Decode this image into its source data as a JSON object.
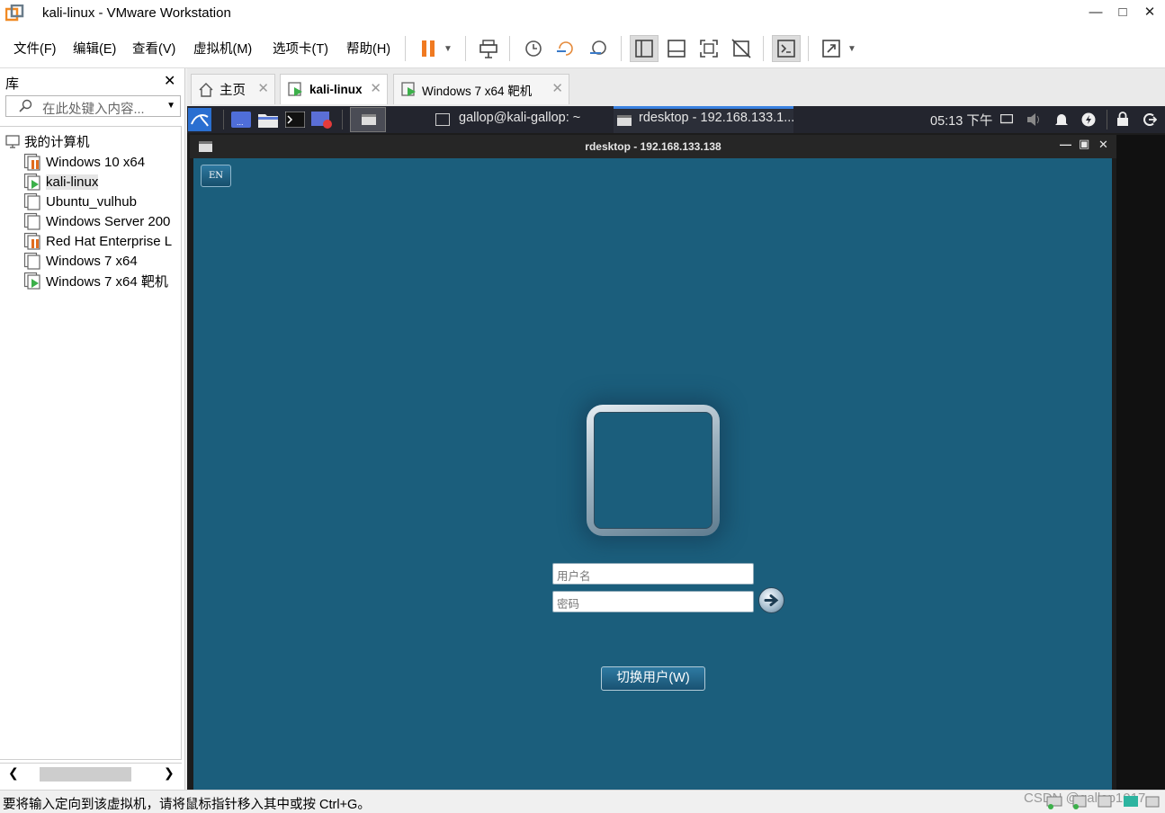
{
  "window": {
    "title": "kali-linux - VMware Workstation"
  },
  "menu": [
    "文件(F)",
    "编辑(E)",
    "查看(V)",
    "虚拟机(M)",
    "选项卡(T)",
    "帮助(H)"
  ],
  "library": {
    "title": "库",
    "search_placeholder": "在此处键入内容...",
    "root": "我的计算机",
    "vms": [
      {
        "name": "Windows 10 x64",
        "state": "suspended"
      },
      {
        "name": "kali-linux",
        "state": "running",
        "selected": true
      },
      {
        "name": "Ubuntu_vulhub",
        "state": "off"
      },
      {
        "name": "Windows Server 200",
        "state": "off"
      },
      {
        "name": "Red Hat Enterprise L",
        "state": "suspended"
      },
      {
        "name": "Windows 7 x64",
        "state": "off"
      },
      {
        "name": "Windows 7 x64 靶机",
        "state": "running"
      }
    ]
  },
  "tabs": [
    {
      "label": "主页",
      "icon": "home-icon"
    },
    {
      "label": "kali-linux",
      "icon": "vm-running-icon",
      "active": true
    },
    {
      "label": "Windows 7 x64 靶机",
      "icon": "vm-running-icon"
    }
  ],
  "kali_panel": {
    "terminal_task": "gallop@kali-gallop: ~",
    "rdesktop_task": "rdesktop - 192.168.133.1...",
    "clock": "05:13 下午"
  },
  "rdesktop": {
    "title": "rdesktop - 192.168.133.138",
    "lang_button": "EN",
    "username_placeholder": "用户名",
    "password_placeholder": "密码",
    "switch_user": "切换用户(W)"
  },
  "status": {
    "message": "要将输入定向到该虚拟机，请将鼠标指针移入其中或按 Ctrl+G。",
    "watermark": "CSDN @gallop1017"
  },
  "colors": {
    "login_bg": "#1b5e7c",
    "kali_panel": "#23252e",
    "accent_running": "#3cb04a",
    "accent_suspended": "#e06c1e"
  }
}
